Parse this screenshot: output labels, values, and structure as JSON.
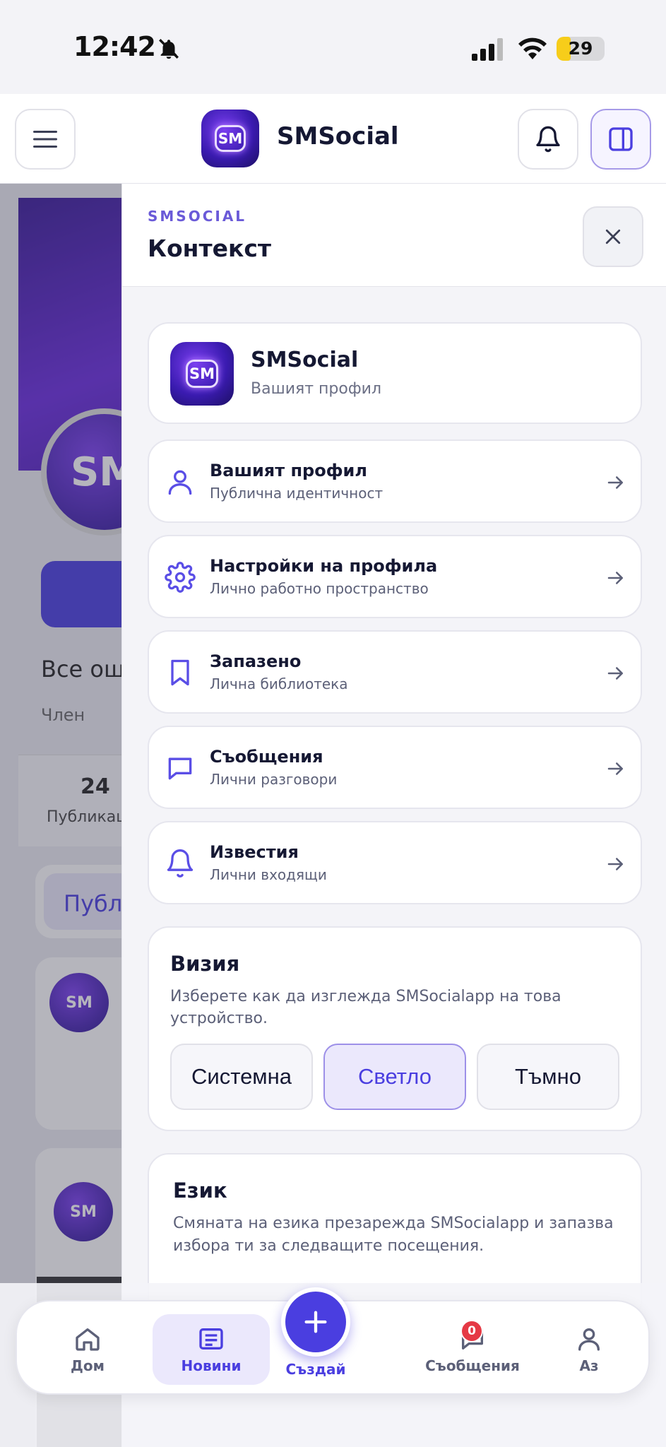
{
  "status_bar": {
    "time": "12:42",
    "battery": "29",
    "battery_level": 0.29
  },
  "header": {
    "brand": "SMSocial",
    "logo_text": "SM"
  },
  "background_page": {
    "avatar_text": "SM",
    "line1": "Все ощ",
    "line2": "Член",
    "stat_number": "24",
    "stat_label": "Публикац",
    "tab_label": "Публ",
    "post_avatar_text": "SM"
  },
  "drawer": {
    "eyebrow": "SMSOCIAL",
    "title": "Контекст",
    "profile": {
      "logo_text": "SM",
      "name": "SMSocial",
      "subtitle": "Вашият профил"
    },
    "items": [
      {
        "label": "Вашият профил",
        "sub": "Публична идентичност",
        "icon": "user-icon"
      },
      {
        "label": "Настройки на профила",
        "sub": "Лично работно пространство",
        "icon": "gear-icon"
      },
      {
        "label": "Запазено",
        "sub": "Лична библиотека",
        "icon": "bookmark-icon"
      },
      {
        "label": "Съобщения",
        "sub": "Лични разговори",
        "icon": "chat-icon"
      },
      {
        "label": "Известия",
        "sub": "Лични входящи",
        "icon": "bell-icon"
      }
    ],
    "theme": {
      "heading": "Визия",
      "description": "Изберете как да изглежда SMSocialapp на това устройство.",
      "options": [
        "Системна",
        "Светло",
        "Тъмно"
      ],
      "selected": "Светло"
    },
    "language": {
      "heading": "Език",
      "description": "Смяната на езика презарежда SMSocialapp и запазва избора ти за следващите посещения."
    }
  },
  "bottom_nav": {
    "home": "Дом",
    "news": "Новини",
    "create": "Създай",
    "messages": "Съобщения",
    "messages_badge": "0",
    "me": "Аз",
    "active": "Новини"
  },
  "colors": {
    "accent": "#4a3ee0",
    "badge": "#e53945",
    "battery": "#f7cd1a"
  }
}
